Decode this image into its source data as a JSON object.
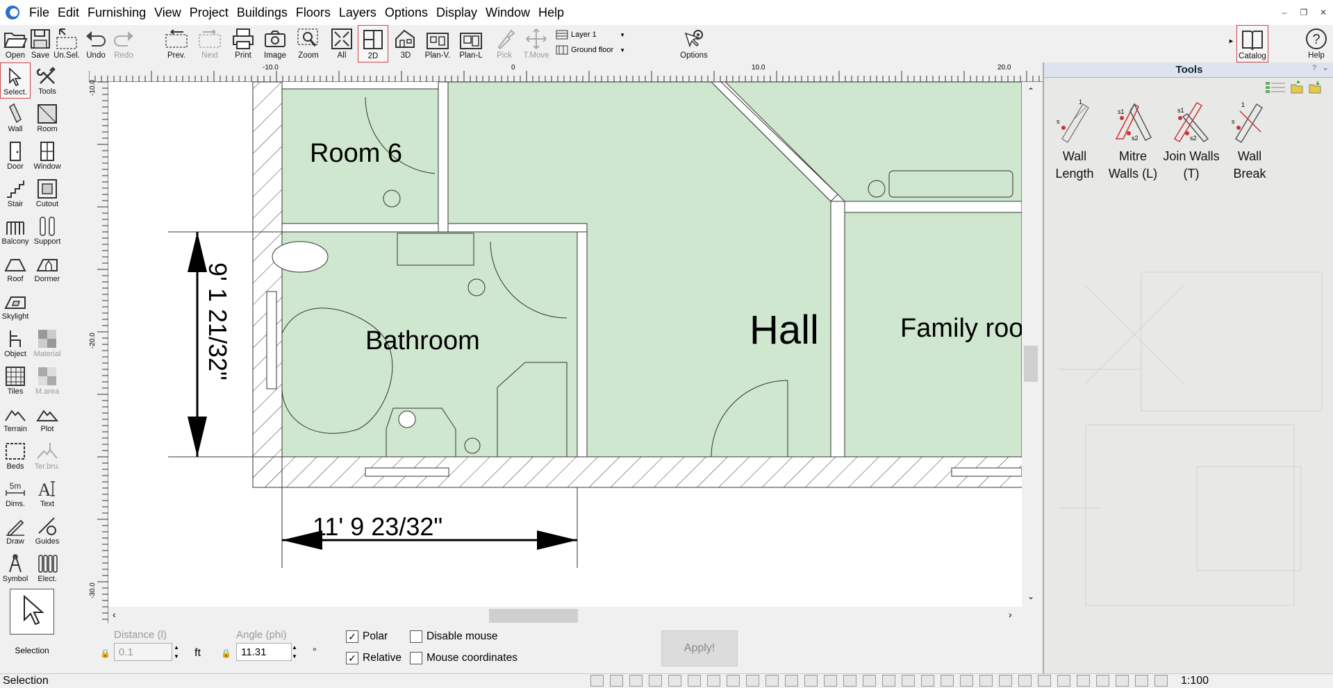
{
  "menubar": {
    "items": [
      "File",
      "Edit",
      "Furnishing",
      "View",
      "Project",
      "Buildings",
      "Floors",
      "Layers",
      "Options",
      "Display",
      "Window",
      "Help"
    ]
  },
  "toolbar": {
    "open": "Open",
    "save": "Save",
    "unsel": "Un.Sel.",
    "undo": "Undo",
    "redo": "Redo",
    "prev": "Prev.",
    "next": "Next",
    "print": "Print",
    "image": "Image",
    "zoom": "Zoom",
    "all": "All",
    "view2d": "2D",
    "view3d": "3D",
    "planv": "Plan-V.",
    "planl": "Plan-L",
    "pick": "Pick",
    "tmove": "T.Move",
    "layer": "Layer 1",
    "floor": "Ground floor",
    "options": "Options",
    "catalog": "Catalog",
    "help": "Help"
  },
  "lefttools": {
    "select": "Select.",
    "tools": "Tools",
    "wall": "Wall",
    "room": "Room",
    "door": "Door",
    "window": "Window",
    "stair": "Stair",
    "cutout": "Cutout",
    "balcony": "Balcony",
    "support": "Support",
    "roof": "Roof",
    "dormer": "Dormer",
    "skylight": "Skylight",
    "object": "Object",
    "material": "Material",
    "tiles": "Tiles",
    "marea": "M.area",
    "terrain": "Terrain",
    "plot": "Plot",
    "beds": "Beds",
    "terbru": "Ter.bru.",
    "dims": "Dims.",
    "text": "Text",
    "draw": "Draw",
    "guides": "Guides",
    "symbol": "Symbol",
    "elect": "Elect.",
    "selection": "Selection",
    "dims_icon": "5m",
    "text_icon": "A"
  },
  "ruler": {
    "unit": "ft",
    "top_ticks": [
      "-10.0",
      "0",
      "10.0",
      "20.0"
    ],
    "left_ticks": [
      "-10.0",
      "-20.0",
      "-30.0"
    ]
  },
  "plan": {
    "rooms": [
      "Room 6",
      "Bathroom",
      "Hall",
      "Family roo"
    ],
    "dim_vertical": "9' 1 21/32\"",
    "dim_horizontal": "11' 9 23/32\""
  },
  "inputbar": {
    "distance_label": "Distance (l)",
    "distance_value": "0.1",
    "distance_unit": "ft",
    "angle_label": "Angle (phi)",
    "angle_value": "11.31",
    "angle_unit": "°",
    "polar": "Polar",
    "relative": "Relative",
    "disable_mouse": "Disable mouse",
    "mouse_coords": "Mouse coordinates",
    "apply": "Apply!",
    "polar_checked": true,
    "relative_checked": true
  },
  "tools_panel": {
    "title": "Tools",
    "items": [
      "Wall Length",
      "Mitre Walls (L)",
      "Join Walls (T)",
      "Wall Break"
    ]
  },
  "status": {
    "text": "Selection",
    "scale": "1:100"
  },
  "colors": {
    "room_fill": "#cfe6cf",
    "accent_red": "#c44444"
  }
}
